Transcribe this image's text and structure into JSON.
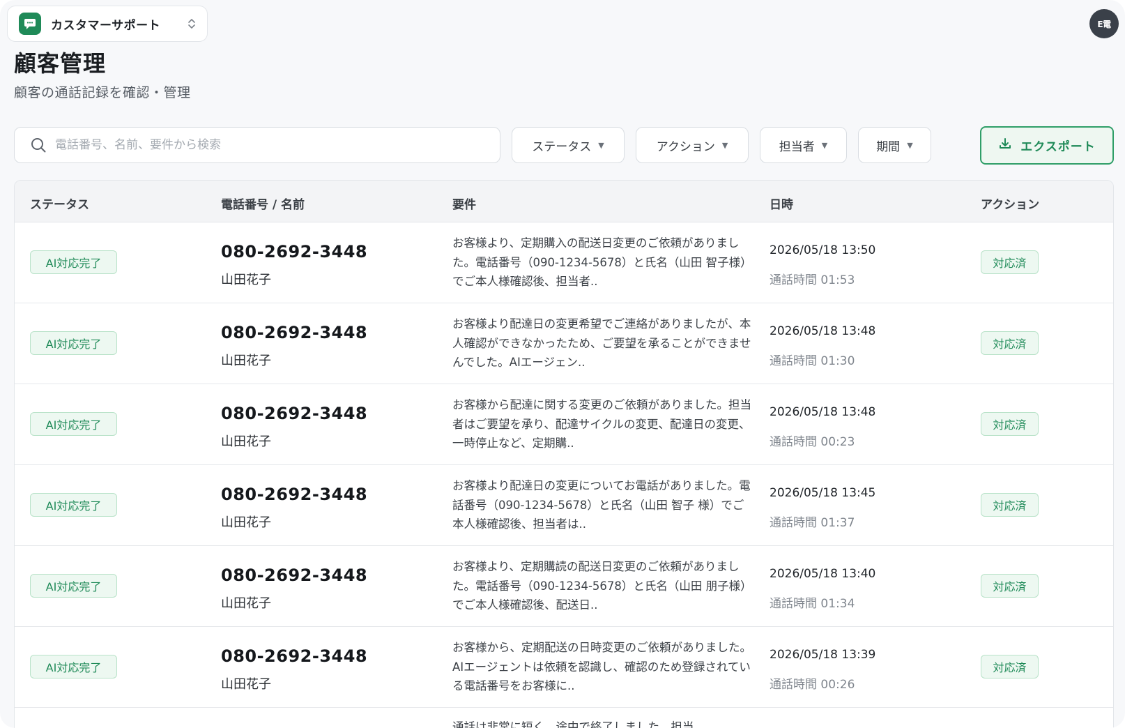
{
  "workspace": {
    "name": "カスタマーサポート"
  },
  "user": {
    "avatar_initials": "E電"
  },
  "page": {
    "title": "顧客管理",
    "subtitle": "顧客の通話記録を確認・管理"
  },
  "search": {
    "placeholder": "電話番号、名前、要件から検索",
    "value": ""
  },
  "filters": {
    "status": "ステータス",
    "action": "アクション",
    "assignee": "担当者",
    "period": "期間",
    "caret": "▼"
  },
  "export": {
    "label": "エクスポート"
  },
  "table": {
    "headers": {
      "status": "ステータス",
      "phone_name": "電話番号 / 名前",
      "summary": "要件",
      "datetime": "日時",
      "action": "アクション"
    },
    "rows": [
      {
        "status": "AI対応完了",
        "phone": "080-2692-3448",
        "name": "山田花子",
        "summary": "お客様より、定期購入の配送日変更のご依頼がありました。電話番号（090-1234-5678）と氏名（山田 智子様）でご本人様確認後、担当者..",
        "datetime": "2026/05/18 13:50",
        "duration": "通話時間 01:53",
        "action": "対応済"
      },
      {
        "status": "AI対応完了",
        "phone": "080-2692-3448",
        "name": "山田花子",
        "summary": "お客様より配達日の変更希望でご連絡がありましたが、本人確認ができなかったため、ご要望を承ることができませんでした。AIエージェン..",
        "datetime": "2026/05/18 13:48",
        "duration": "通話時間 01:30",
        "action": "対応済"
      },
      {
        "status": "AI対応完了",
        "phone": "080-2692-3448",
        "name": "山田花子",
        "summary": "お客様から配達に関する変更のご依頼がありました。担当者はご要望を承り、配達サイクルの変更、配達日の変更、一時停止など、定期購..",
        "datetime": "2026/05/18 13:48",
        "duration": "通話時間 00:23",
        "action": "対応済"
      },
      {
        "status": "AI対応完了",
        "phone": "080-2692-3448",
        "name": "山田花子",
        "summary": "お客様より配達日の変更についてお電話がありました。電話番号（090-1234-5678）と氏名（山田 智子 様）でご本人様確認後、担当者は..",
        "datetime": "2026/05/18 13:45",
        "duration": "通話時間 01:37",
        "action": "対応済"
      },
      {
        "status": "AI対応完了",
        "phone": "080-2692-3448",
        "name": "山田花子",
        "summary": "お客様より、定期購読の配送日変更のご依頼がありました。電話番号（090-1234-5678）と氏名（山田 朋子様）でご本人様確認後、配送日..",
        "datetime": "2026/05/18 13:40",
        "duration": "通話時間 01:34",
        "action": "対応済"
      },
      {
        "status": "AI対応完了",
        "phone": "080-2692-3448",
        "name": "山田花子",
        "summary": "お客様から、定期配送の日時変更のご依頼がありました。AIエージェントは依頼を認識し、確認のため登録されている電話番号をお客様に..",
        "datetime": "2026/05/18 13:39",
        "duration": "通話時間 00:26",
        "action": "対応済"
      }
    ],
    "partial_row_summary": "通話は非常に短く、途中で終了しました。担当"
  },
  "colors": {
    "accent": "#1f8a58",
    "badge_bg": "#edf8f1",
    "badge_border": "#b8e2c8",
    "page_bg": "#f7f8fa"
  },
  "icons": {
    "workspace": "chat-bubble-icon",
    "workspace_switch": "chevron-updown-icon",
    "search": "search-icon",
    "export": "download-icon"
  }
}
